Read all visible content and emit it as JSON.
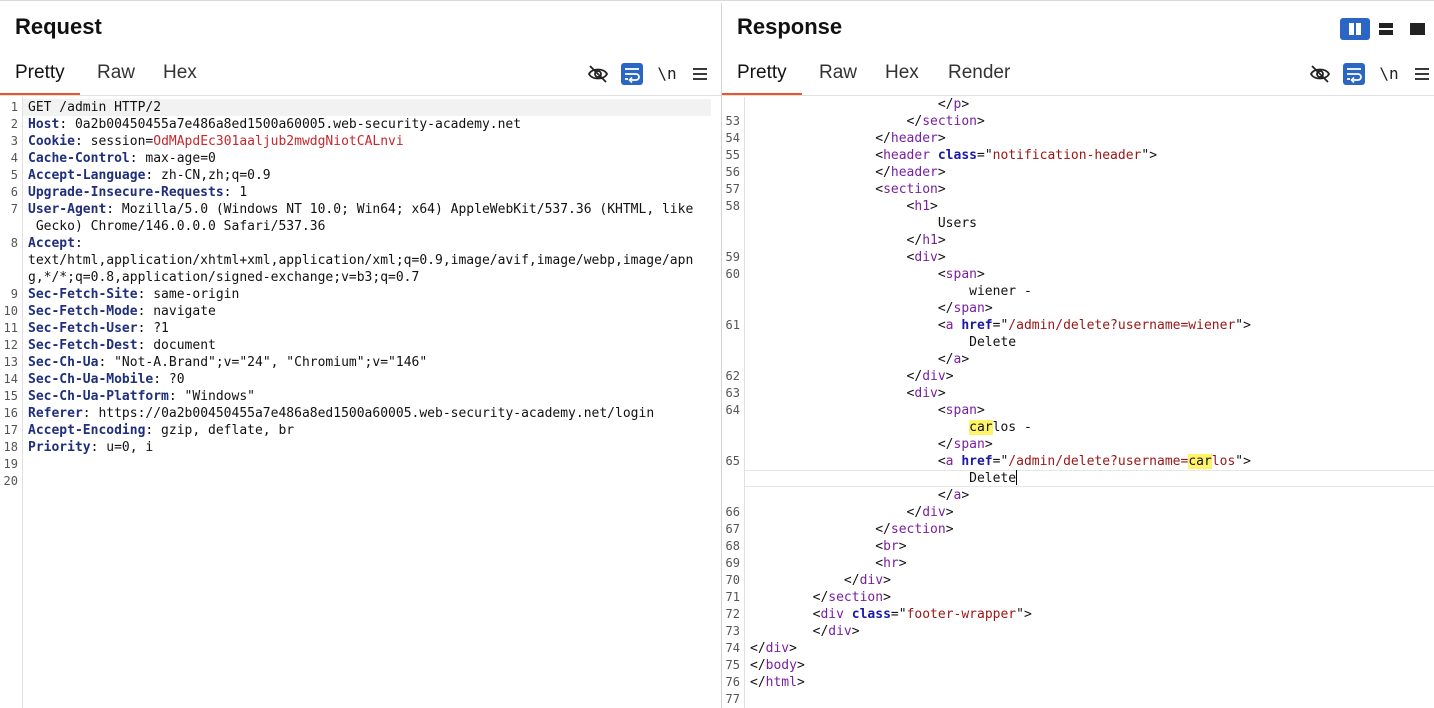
{
  "request": {
    "title": "Request",
    "tabs": [
      "Pretty",
      "Raw",
      "Hex"
    ],
    "active_tab": "Pretty",
    "toolbar": {
      "newline_toggle": "\\n"
    },
    "lines": [
      {
        "n": "1",
        "key": "",
        "val": "GET /admin HTTP/2"
      },
      {
        "n": "2",
        "key": "Host",
        "val": " 0a2b00450455a7e486a8ed1500a60005.web-security-academy.net"
      },
      {
        "n": "3",
        "key": "Cookie",
        "val": " session=",
        "cookie": "OdMApdEc301aaljub2mwdgNiotCALnvi"
      },
      {
        "n": "4",
        "key": "Cache-Control",
        "val": " max-age=0"
      },
      {
        "n": "5",
        "key": "Accept-Language",
        "val": " zh-CN,zh;q=0.9"
      },
      {
        "n": "6",
        "key": "Upgrade-Insecure-Requests",
        "val": " 1"
      },
      {
        "n": "7",
        "key": "User-Agent",
        "val": " Mozilla/5.0 (Windows NT 10.0; Win64; x64) AppleWebKit/537.36 (KHTML, like"
      },
      {
        "n": "",
        "key": "",
        "val": " Gecko) Chrome/146.0.0.0 Safari/537.36"
      },
      {
        "n": "8",
        "key": "Accept",
        "val": ""
      },
      {
        "n": "",
        "key": "",
        "val": "text/html,application/xhtml+xml,application/xml;q=0.9,image/avif,image/webp,image/apn"
      },
      {
        "n": "",
        "key": "",
        "val": "g,*/*;q=0.8,application/signed-exchange;v=b3;q=0.7"
      },
      {
        "n": "9",
        "key": "Sec-Fetch-Site",
        "val": " same-origin"
      },
      {
        "n": "10",
        "key": "Sec-Fetch-Mode",
        "val": " navigate"
      },
      {
        "n": "11",
        "key": "Sec-Fetch-User",
        "val": " ?1"
      },
      {
        "n": "12",
        "key": "Sec-Fetch-Dest",
        "val": " document"
      },
      {
        "n": "13",
        "key": "Sec-Ch-Ua",
        "val": " \"Not-A.Brand\";v=\"24\", \"Chromium\";v=\"146\""
      },
      {
        "n": "14",
        "key": "Sec-Ch-Ua-Mobile",
        "val": " ?0"
      },
      {
        "n": "15",
        "key": "Sec-Ch-Ua-Platform",
        "val": " \"Windows\""
      },
      {
        "n": "16",
        "key": "Referer",
        "val": " https://0a2b00450455a7e486a8ed1500a60005.web-security-academy.net/login"
      },
      {
        "n": "17",
        "key": "Accept-Encoding",
        "val": " gzip, deflate, br"
      },
      {
        "n": "18",
        "key": "Priority",
        "val": " u=0, i"
      },
      {
        "n": "19",
        "key": "",
        "val": ""
      },
      {
        "n": "20",
        "key": "",
        "val": ""
      }
    ]
  },
  "response": {
    "title": "Response",
    "tabs": [
      "Pretty",
      "Raw",
      "Hex",
      "Render"
    ],
    "active_tab": "Pretty",
    "toolbar": {
      "newline_toggle": "\\n"
    },
    "highlight_term": "car",
    "lines": [
      {
        "n": "",
        "indent": "                        ",
        "parts": [
          [
            "p",
            "</"
          ],
          [
            "t",
            "p"
          ],
          [
            "p",
            ">"
          ]
        ]
      },
      {
        "n": "53",
        "indent": "                    ",
        "parts": [
          [
            "p",
            "</"
          ],
          [
            "t",
            "section"
          ],
          [
            "p",
            ">"
          ]
        ]
      },
      {
        "n": "54",
        "indent": "                ",
        "parts": [
          [
            "p",
            "</"
          ],
          [
            "t",
            "header"
          ],
          [
            "p",
            ">"
          ]
        ]
      },
      {
        "n": "55",
        "indent": "                ",
        "parts": [
          [
            "p",
            "<"
          ],
          [
            "t",
            "header"
          ],
          [
            "p",
            " "
          ],
          [
            "a",
            "class"
          ],
          [
            "p",
            "=\""
          ],
          [
            "s",
            "notification-header"
          ],
          [
            "p",
            "\">"
          ]
        ]
      },
      {
        "n": "56",
        "indent": "                ",
        "parts": [
          [
            "p",
            "</"
          ],
          [
            "t",
            "header"
          ],
          [
            "p",
            ">"
          ]
        ]
      },
      {
        "n": "57",
        "indent": "                ",
        "parts": [
          [
            "p",
            "<"
          ],
          [
            "t",
            "section"
          ],
          [
            "p",
            ">"
          ]
        ]
      },
      {
        "n": "58",
        "indent": "                    ",
        "parts": [
          [
            "p",
            "<"
          ],
          [
            "t",
            "h1"
          ],
          [
            "p",
            ">"
          ]
        ]
      },
      {
        "n": "",
        "indent": "                        ",
        "parts": [
          [
            "x",
            "Users"
          ]
        ]
      },
      {
        "n": "",
        "indent": "                    ",
        "parts": [
          [
            "p",
            "</"
          ],
          [
            "t",
            "h1"
          ],
          [
            "p",
            ">"
          ]
        ]
      },
      {
        "n": "59",
        "indent": "                    ",
        "parts": [
          [
            "p",
            "<"
          ],
          [
            "t",
            "div"
          ],
          [
            "p",
            ">"
          ]
        ]
      },
      {
        "n": "60",
        "indent": "                        ",
        "parts": [
          [
            "p",
            "<"
          ],
          [
            "t",
            "span"
          ],
          [
            "p",
            ">"
          ]
        ]
      },
      {
        "n": "",
        "indent": "                            ",
        "parts": [
          [
            "x",
            "wiener -"
          ]
        ]
      },
      {
        "n": "",
        "indent": "                        ",
        "parts": [
          [
            "p",
            "</"
          ],
          [
            "t",
            "span"
          ],
          [
            "p",
            ">"
          ]
        ]
      },
      {
        "n": "61",
        "indent": "                        ",
        "parts": [
          [
            "p",
            "<"
          ],
          [
            "t",
            "a"
          ],
          [
            "p",
            " "
          ],
          [
            "a",
            "href"
          ],
          [
            "p",
            "=\""
          ],
          [
            "s",
            "/admin/delete?username=wiener"
          ],
          [
            "p",
            "\">"
          ]
        ]
      },
      {
        "n": "",
        "indent": "                            ",
        "parts": [
          [
            "x",
            "Delete"
          ]
        ]
      },
      {
        "n": "",
        "indent": "                        ",
        "parts": [
          [
            "p",
            "</"
          ],
          [
            "t",
            "a"
          ],
          [
            "p",
            ">"
          ]
        ]
      },
      {
        "n": "62",
        "indent": "                    ",
        "parts": [
          [
            "p",
            "</"
          ],
          [
            "t",
            "div"
          ],
          [
            "p",
            ">"
          ]
        ]
      },
      {
        "n": "63",
        "indent": "                    ",
        "parts": [
          [
            "p",
            "<"
          ],
          [
            "t",
            "div"
          ],
          [
            "p",
            ">"
          ]
        ]
      },
      {
        "n": "64",
        "indent": "                        ",
        "parts": [
          [
            "p",
            "<"
          ],
          [
            "t",
            "span"
          ],
          [
            "p",
            ">"
          ]
        ]
      },
      {
        "n": "",
        "indent": "                            ",
        "parts": [
          [
            "h",
            "car"
          ],
          [
            "x",
            "los -"
          ]
        ]
      },
      {
        "n": "",
        "indent": "                        ",
        "parts": [
          [
            "p",
            "</"
          ],
          [
            "t",
            "span"
          ],
          [
            "p",
            ">"
          ]
        ]
      },
      {
        "n": "65",
        "indent": "                        ",
        "parts": [
          [
            "p",
            "<"
          ],
          [
            "t",
            "a"
          ],
          [
            "p",
            " "
          ],
          [
            "a",
            "href"
          ],
          [
            "p",
            "=\""
          ],
          [
            "s",
            "/admin/delete?username="
          ],
          [
            "h",
            "car"
          ],
          [
            "s",
            "los"
          ],
          [
            "p",
            "\">"
          ]
        ]
      },
      {
        "n": "",
        "indent": "                            ",
        "parts": [
          [
            "x",
            "Delete"
          ]
        ],
        "cursor": true
      },
      {
        "n": "",
        "indent": "                        ",
        "parts": [
          [
            "p",
            "</"
          ],
          [
            "t",
            "a"
          ],
          [
            "p",
            ">"
          ]
        ]
      },
      {
        "n": "66",
        "indent": "                    ",
        "parts": [
          [
            "p",
            "</"
          ],
          [
            "t",
            "div"
          ],
          [
            "p",
            ">"
          ]
        ]
      },
      {
        "n": "67",
        "indent": "                ",
        "parts": [
          [
            "p",
            "</"
          ],
          [
            "t",
            "section"
          ],
          [
            "p",
            ">"
          ]
        ]
      },
      {
        "n": "68",
        "indent": "                ",
        "parts": [
          [
            "p",
            "<"
          ],
          [
            "t",
            "br"
          ],
          [
            "p",
            ">"
          ]
        ]
      },
      {
        "n": "69",
        "indent": "                ",
        "parts": [
          [
            "p",
            "<"
          ],
          [
            "t",
            "hr"
          ],
          [
            "p",
            ">"
          ]
        ]
      },
      {
        "n": "70",
        "indent": "            ",
        "parts": [
          [
            "p",
            "</"
          ],
          [
            "t",
            "div"
          ],
          [
            "p",
            ">"
          ]
        ]
      },
      {
        "n": "71",
        "indent": "        ",
        "parts": [
          [
            "p",
            "</"
          ],
          [
            "t",
            "section"
          ],
          [
            "p",
            ">"
          ]
        ]
      },
      {
        "n": "72",
        "indent": "        ",
        "parts": [
          [
            "p",
            "<"
          ],
          [
            "t",
            "div"
          ],
          [
            "p",
            " "
          ],
          [
            "a",
            "class"
          ],
          [
            "p",
            "=\""
          ],
          [
            "s",
            "footer-wrapper"
          ],
          [
            "p",
            "\">"
          ]
        ]
      },
      {
        "n": "73",
        "indent": "        ",
        "parts": [
          [
            "p",
            "</"
          ],
          [
            "t",
            "div"
          ],
          [
            "p",
            ">"
          ]
        ]
      },
      {
        "n": "74",
        "indent": "",
        "parts": [
          [
            "p",
            "</"
          ],
          [
            "t",
            "div"
          ],
          [
            "p",
            ">"
          ]
        ]
      },
      {
        "n": "75",
        "indent": "",
        "parts": [
          [
            "p",
            "</"
          ],
          [
            "t",
            "body"
          ],
          [
            "p",
            ">"
          ]
        ]
      },
      {
        "n": "76",
        "indent": "",
        "parts": [
          [
            "p",
            "</"
          ],
          [
            "t",
            "html"
          ],
          [
            "p",
            ">"
          ]
        ]
      },
      {
        "n": "77",
        "indent": "",
        "parts": []
      }
    ]
  },
  "colors": {
    "accent_tab_underline": "#e8582c",
    "active_tool": "#2b66c4",
    "header_key": "#1f2f7a",
    "html_tag": "#7a1fa2",
    "html_attr": "#1a1aa6",
    "html_string": "#9b1515",
    "search_highlight": "#fff36a"
  }
}
